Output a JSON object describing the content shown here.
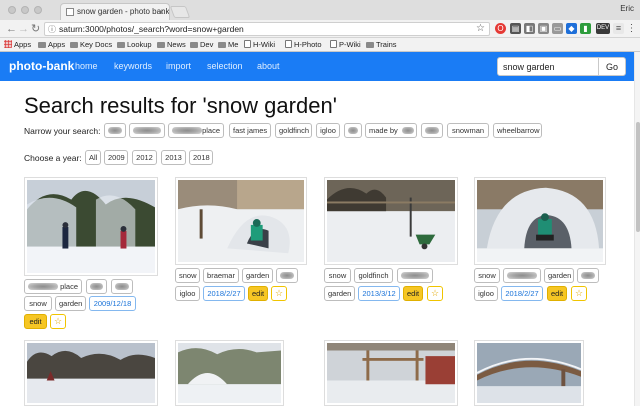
{
  "browser": {
    "tab_title": "snow garden - photo bank",
    "user": "Eric",
    "url": "saturn:3000/photos/_search?word=snow+garden",
    "bookmarks": [
      "Apps",
      "Apps",
      "Key Docs",
      "Lookup",
      "News",
      "Dev",
      "Me",
      "H-Wiki",
      "H-Photo",
      "P-Wiki",
      "Trains"
    ]
  },
  "nav": {
    "brand": "photo-bank",
    "links": [
      "home",
      "keywords",
      "import",
      "selection",
      "about"
    ],
    "search_value": "snow garden",
    "go_label": "Go"
  },
  "page": {
    "title": "Search results for 'snow garden'",
    "narrow_label": "Narrow your search:",
    "narrow_tags": [
      "place",
      "fast james",
      "goldfinch",
      "igloo",
      "made by",
      "snowman",
      "wheelbarrow"
    ],
    "year_label": "Choose a year:",
    "years": [
      "All",
      "2009",
      "2012",
      "2013",
      "2018"
    ]
  },
  "results": [
    {
      "tags": [
        "place",
        "snow",
        "garden"
      ],
      "date": "2009/12/18",
      "edit": "edit",
      "star": "☆"
    },
    {
      "tags": [
        "snow",
        "braemar",
        "garden",
        "igloo"
      ],
      "date": "2018/2/27",
      "edit": "edit",
      "star": "☆"
    },
    {
      "tags": [
        "snow",
        "goldfinch",
        "garden"
      ],
      "date": "2013/3/12",
      "edit": "edit",
      "star": "☆"
    },
    {
      "tags": [
        "snow",
        "garden",
        "igloo"
      ],
      "date": "2018/2/27",
      "edit": "edit",
      "star": "☆"
    }
  ],
  "colors": {
    "navbar": "#1a7cf5",
    "edit_button": "#f6c624",
    "date_link": "#1a73d9"
  }
}
